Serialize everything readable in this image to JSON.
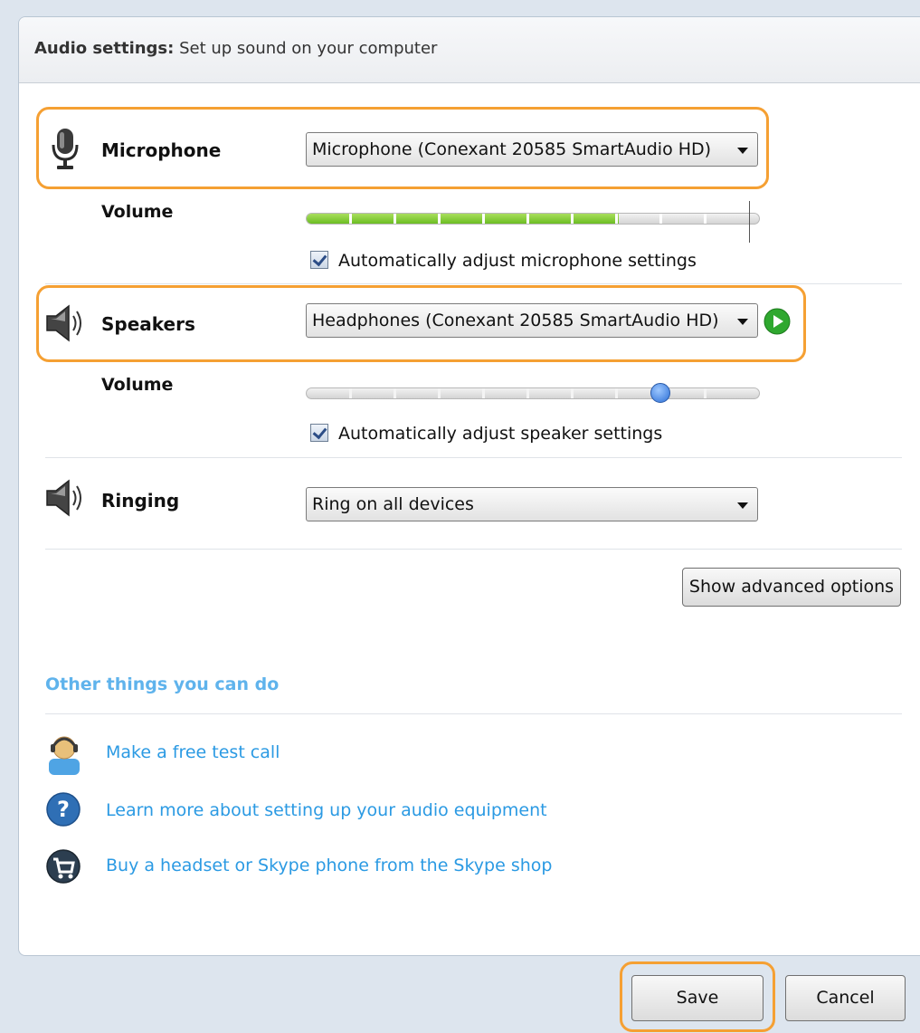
{
  "header": {
    "title": "Audio settings:",
    "subtitle": "Set up sound on your computer"
  },
  "microphone": {
    "label": "Microphone",
    "device": "Microphone (Conexant 20585 SmartAudio HD)",
    "volume_label": "Volume",
    "volume_level": 0.69,
    "auto_adjust_label": "Automatically adjust microphone settings",
    "auto_adjust_checked": true
  },
  "speakers": {
    "label": "Speakers",
    "device": "Headphones (Conexant 20585 SmartAudio HD)",
    "volume_label": "Volume",
    "volume_level": 0.78,
    "auto_adjust_label": "Automatically adjust speaker settings",
    "auto_adjust_checked": true
  },
  "ringing": {
    "label": "Ringing",
    "device": "Ring on all devices"
  },
  "advanced_button": "Show advanced options",
  "other": {
    "heading": "Other things you can do",
    "links": [
      {
        "icon": "test-call-user-icon",
        "label": "Make a free test call"
      },
      {
        "icon": "help-icon",
        "label": "Learn more about setting up your audio equipment"
      },
      {
        "icon": "skype-shop-icon",
        "label": "Buy a headset or Skype phone from the Skype shop"
      }
    ]
  },
  "footer": {
    "save_label": "Save",
    "cancel_label": "Cancel"
  },
  "colors": {
    "highlight": "#f5a033",
    "link": "#2b9ae3",
    "meter_green": "#6cbd23",
    "slider_knob": "#3b7fe0"
  }
}
